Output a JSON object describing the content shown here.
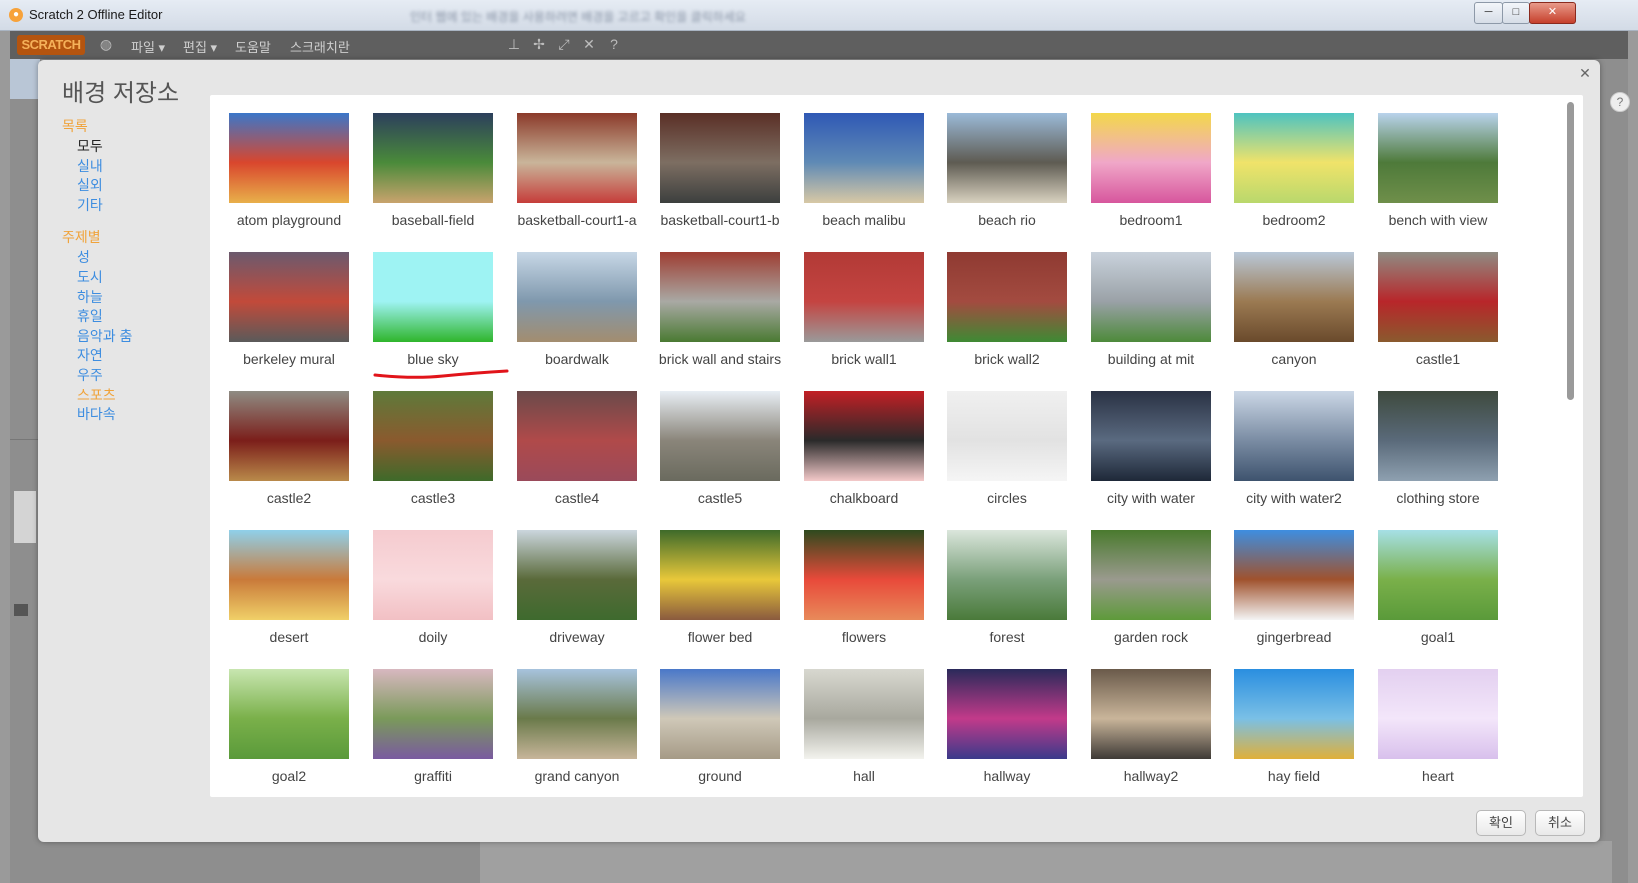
{
  "window": {
    "title": "Scratch 2 Offline Editor",
    "blurred_message": "인터 웹에 있는 배경을 사용하려면 배경을 고르고 확인을 클릭하세요",
    "minimize": "─",
    "maximize": "□",
    "close": "✕"
  },
  "menubar": {
    "logo": "SCRATCH",
    "items": [
      {
        "label": "파일 ▾"
      },
      {
        "label": "편집 ▾"
      },
      {
        "label": "도움말"
      },
      {
        "label": "스크래치란"
      }
    ],
    "tools": [
      "globe-icon",
      "stamp-icon",
      "scissors-icon",
      "grow-icon",
      "shrink-icon",
      "help-icon"
    ]
  },
  "dialog": {
    "title": "배경 저장소",
    "close": "✕",
    "categories": {
      "heading": "목록",
      "items": [
        "모두",
        "실내",
        "실외",
        "기타"
      ],
      "theme_heading": "주제별",
      "themes": [
        "성",
        "도시",
        "하늘",
        "휴일",
        "음악과 춤",
        "자연",
        "우주",
        "스포츠",
        "바다속"
      ]
    },
    "ok_label": "확인",
    "cancel_label": "취소"
  },
  "backdrops": [
    {
      "name": "atom playground",
      "colors": [
        "#3b77c9",
        "#d9462d",
        "#e8b04a"
      ]
    },
    {
      "name": "baseball-field",
      "colors": [
        "#2c3f5c",
        "#4a8a3a",
        "#c9a36d"
      ]
    },
    {
      "name": "basketball-court1-a",
      "colors": [
        "#8b3a2a",
        "#c9b59a",
        "#c63d3a"
      ]
    },
    {
      "name": "basketball-court1-b",
      "colors": [
        "#5a2f26",
        "#7d6e62",
        "#3c3f3e"
      ]
    },
    {
      "name": "beach malibu",
      "colors": [
        "#2f58b5",
        "#5f8ab5",
        "#d8c8a5"
      ]
    },
    {
      "name": "beach rio",
      "colors": [
        "#9bbad8",
        "#5e5b52",
        "#d9d2c0"
      ]
    },
    {
      "name": "bedroom1",
      "colors": [
        "#f3d84a",
        "#f0a7c8",
        "#d7569d"
      ]
    },
    {
      "name": "bedroom2",
      "colors": [
        "#4ec3c0",
        "#f0e36a",
        "#b9d86c"
      ]
    },
    {
      "name": "bench with view",
      "colors": [
        "#b9d3ec",
        "#4e7a3a",
        "#6f8f4a"
      ]
    },
    {
      "name": "berkeley mural",
      "colors": [
        "#6b5a6e",
        "#c24a3a",
        "#5a5a5a"
      ]
    },
    {
      "name": "blue sky",
      "colors": [
        "#9ef3f3",
        "#9ef3f3",
        "#2fb52c"
      ]
    },
    {
      "name": "boardwalk",
      "colors": [
        "#c7d7e6",
        "#7f98ad",
        "#a38d6f"
      ]
    },
    {
      "name": "brick wall and stairs",
      "colors": [
        "#9e3d32",
        "#a9a9a4",
        "#4a7a32"
      ]
    },
    {
      "name": "brick wall1",
      "colors": [
        "#b23a36",
        "#c44441",
        "#9a9a9a"
      ]
    },
    {
      "name": "brick wall2",
      "colors": [
        "#8f3a32",
        "#a34b40",
        "#3e8a34"
      ]
    },
    {
      "name": "building at mit",
      "colors": [
        "#c9d2dc",
        "#9aa1a7",
        "#4d8a3a"
      ]
    },
    {
      "name": "canyon",
      "colors": [
        "#b9c8d8",
        "#9b7a52",
        "#6a4a2c"
      ]
    },
    {
      "name": "castle1",
      "colors": [
        "#8f8c83",
        "#b8262a",
        "#8a5a2e"
      ]
    },
    {
      "name": "castle2",
      "colors": [
        "#8f8c83",
        "#7b1e1a",
        "#b98a4a"
      ]
    },
    {
      "name": "castle3",
      "colors": [
        "#5e7a3a",
        "#8a5a2e",
        "#3e6a2a"
      ]
    },
    {
      "name": "castle4",
      "colors": [
        "#6a4a4a",
        "#b04a4a",
        "#9a4a5a"
      ]
    },
    {
      "name": "castle5",
      "colors": [
        "#e8eef4",
        "#8a857a",
        "#6a6a5e"
      ]
    },
    {
      "name": "chalkboard",
      "colors": [
        "#c21f25",
        "#2a2a2a",
        "#f3c9c9"
      ]
    },
    {
      "name": "circles",
      "colors": [
        "#f0f0f0",
        "#e2e2e2",
        "#f5f5f5"
      ]
    },
    {
      "name": "city with water",
      "colors": [
        "#2a3244",
        "#5a6a80",
        "#1e2838"
      ]
    },
    {
      "name": "city with water2",
      "colors": [
        "#cbd7e6",
        "#7a8ca3",
        "#3e536e"
      ]
    },
    {
      "name": "clothing store",
      "colors": [
        "#3e4a3e",
        "#5a6a7a",
        "#8ea0b0"
      ]
    },
    {
      "name": "desert",
      "colors": [
        "#8fd0ea",
        "#c97a3a",
        "#f0d068"
      ]
    },
    {
      "name": "doily",
      "colors": [
        "#f5cbcf",
        "#f9dadd",
        "#f2c0c4"
      ]
    },
    {
      "name": "driveway",
      "colors": [
        "#cbd6de",
        "#5a6a3a",
        "#3e6a2e"
      ]
    },
    {
      "name": "flower bed",
      "colors": [
        "#3e6a2a",
        "#e8c83a",
        "#8a5a3e"
      ]
    },
    {
      "name": "flowers",
      "colors": [
        "#2e4a1e",
        "#e84a3a",
        "#e88a5a"
      ]
    },
    {
      "name": "forest",
      "colors": [
        "#dbe6dc",
        "#7aa07a",
        "#4a7a3a"
      ]
    },
    {
      "name": "garden rock",
      "colors": [
        "#4a7a2e",
        "#9a9a8e",
        "#5e9a3a"
      ]
    },
    {
      "name": "gingerbread",
      "colors": [
        "#3e8ee0",
        "#a0522d",
        "#f4f4f4"
      ]
    },
    {
      "name": "goal1",
      "colors": [
        "#a6e0e6",
        "#7ab04a",
        "#5a9a3a"
      ]
    },
    {
      "name": "goal2",
      "colors": [
        "#c8e6b0",
        "#7ab04a",
        "#5a9a3a"
      ]
    },
    {
      "name": "graffiti",
      "colors": [
        "#d8b8c0",
        "#7a9a5a",
        "#7a5aa0"
      ]
    },
    {
      "name": "grand canyon",
      "colors": [
        "#a7c3dd",
        "#6a7a4a",
        "#c7b59a"
      ]
    },
    {
      "name": "ground",
      "colors": [
        "#4a78c9",
        "#cfc8b8",
        "#a59a86"
      ]
    },
    {
      "name": "hall",
      "colors": [
        "#d8d8d0",
        "#a8a89e",
        "#f3f3ee"
      ]
    },
    {
      "name": "hallway",
      "colors": [
        "#2a2a5a",
        "#c23a8a",
        "#3a3a8a"
      ]
    },
    {
      "name": "hallway2",
      "colors": [
        "#6a5a4a",
        "#c9b59a",
        "#3e3a36"
      ]
    },
    {
      "name": "hay field",
      "colors": [
        "#2a8ee0",
        "#7ac0e6",
        "#e0b03a"
      ]
    },
    {
      "name": "heart",
      "colors": [
        "#e3d0f0",
        "#f3e6fa",
        "#d8c0ec"
      ]
    }
  ]
}
